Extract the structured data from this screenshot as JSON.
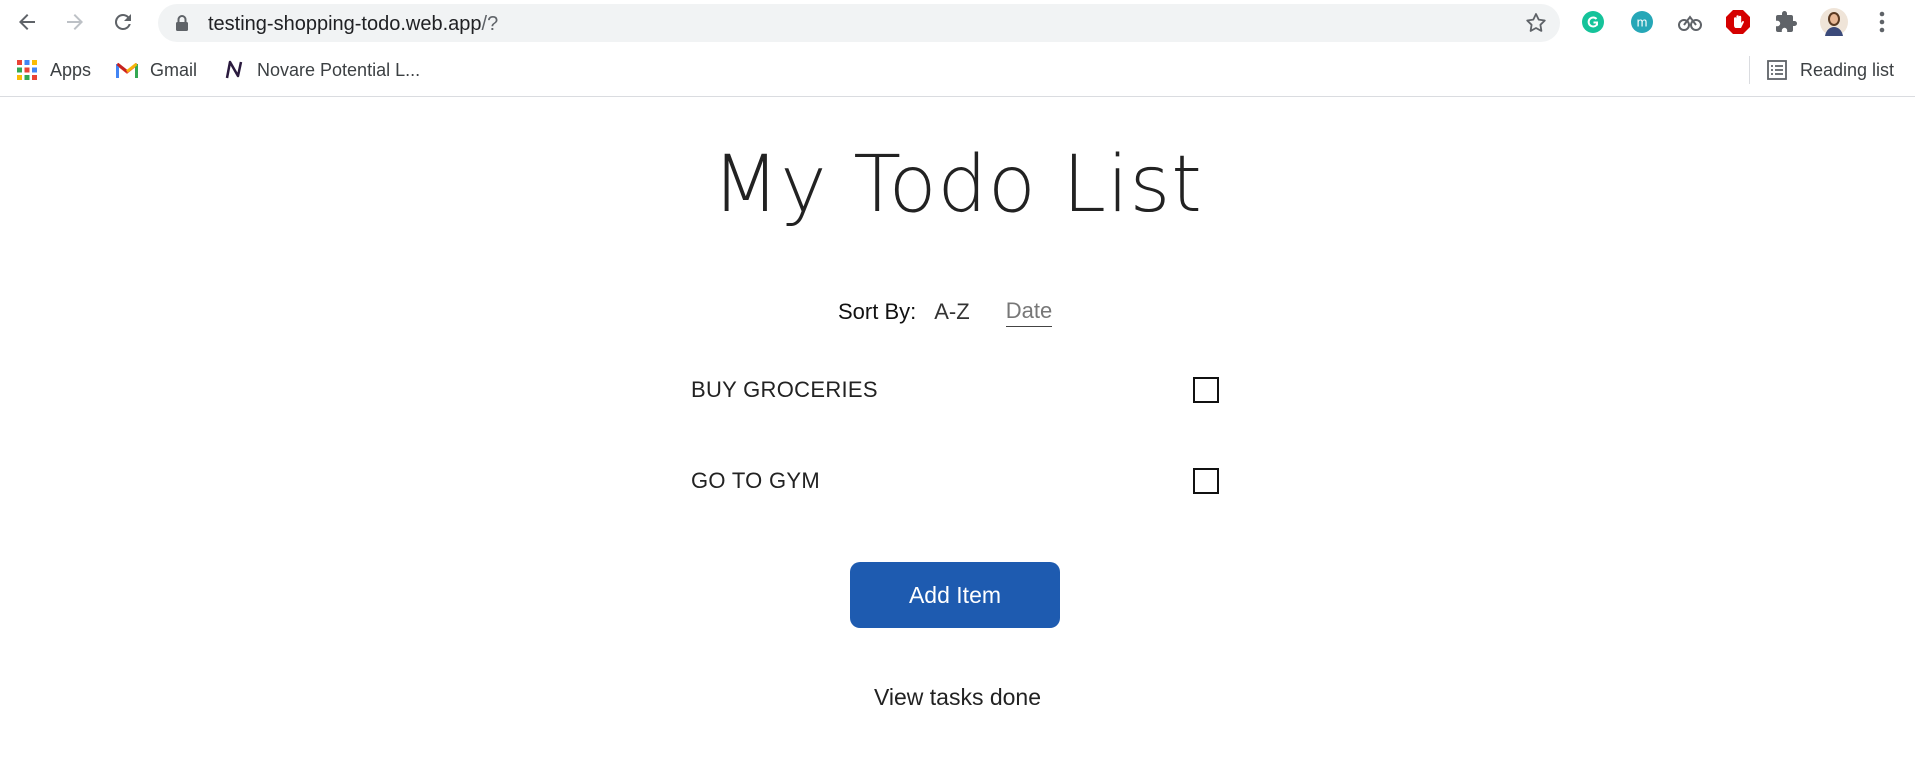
{
  "browser": {
    "url_host": "testing-shopping-todo.web.app",
    "url_path": "/?",
    "bookmarks": [
      {
        "label": "Apps",
        "icon": "apps-grid-icon"
      },
      {
        "label": "Gmail",
        "icon": "gmail-icon"
      },
      {
        "label": "Novare Potential L...",
        "icon": "novare-icon"
      }
    ],
    "reading_list": "Reading list",
    "extensions": [
      "grammarly-icon",
      "m-extension-icon",
      "link-extension-icon",
      "adblock-icon",
      "puzzle-icon",
      "profile-avatar",
      "menu-dots-icon"
    ]
  },
  "page": {
    "title": "My Todo List",
    "sort": {
      "label": "Sort By:",
      "options": [
        "A-Z",
        "Date"
      ],
      "active": "Date"
    },
    "todos": [
      {
        "label": "BUY GROCERIES",
        "checked": false
      },
      {
        "label": "GO TO GYM",
        "checked": false
      }
    ],
    "add_button": "Add Item",
    "view_done_link": "View tasks done"
  },
  "colors": {
    "accent": "#1e5bb0",
    "text": "#222222"
  }
}
